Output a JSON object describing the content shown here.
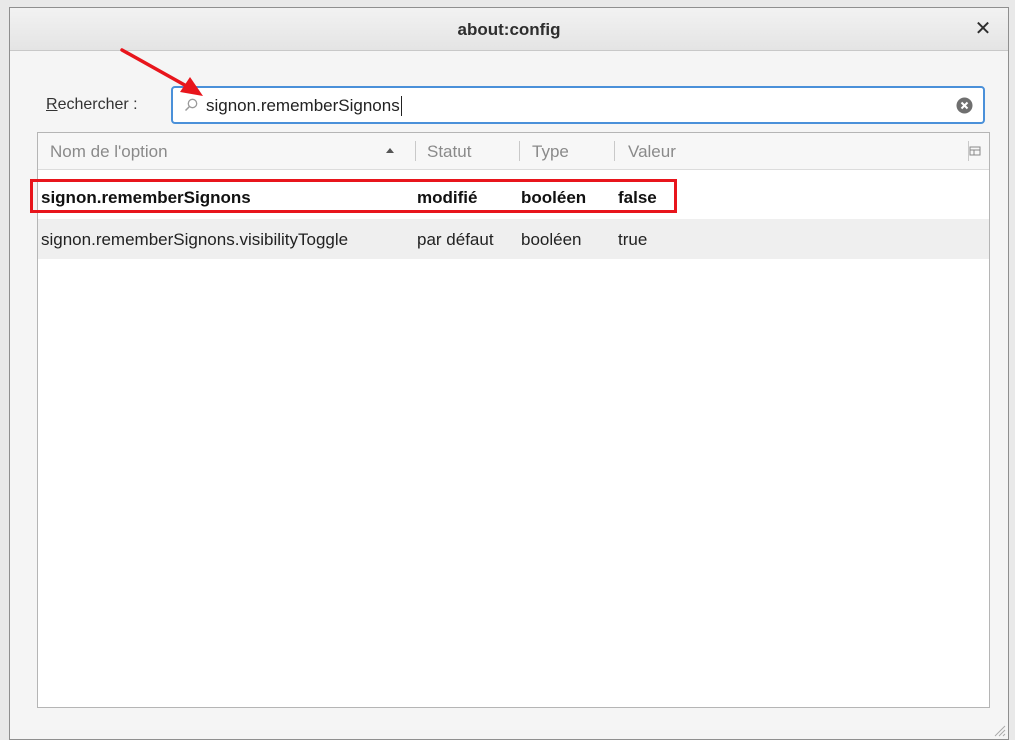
{
  "window": {
    "title": "about:config",
    "close_glyph": "✕"
  },
  "search": {
    "label_accel": "R",
    "label_rest": "echercher :",
    "value": "signon.rememberSignons",
    "icon": "search-icon",
    "clear_icon": "clear-icon"
  },
  "table": {
    "columns": [
      "Nom de l'option",
      "Statut",
      "Type",
      "Valeur"
    ],
    "sorted_column": "Nom de l'option",
    "rows": [
      {
        "name": "signon.rememberSignons",
        "status": "modifié",
        "type": "booléen",
        "value": "false",
        "bold": true
      },
      {
        "name": "signon.rememberSignons.visibilityToggle",
        "status": "par défaut",
        "type": "booléen",
        "value": "true",
        "bold": false
      }
    ]
  },
  "colors": {
    "accent": "#4a90d9",
    "annotation": "#e8151c"
  }
}
